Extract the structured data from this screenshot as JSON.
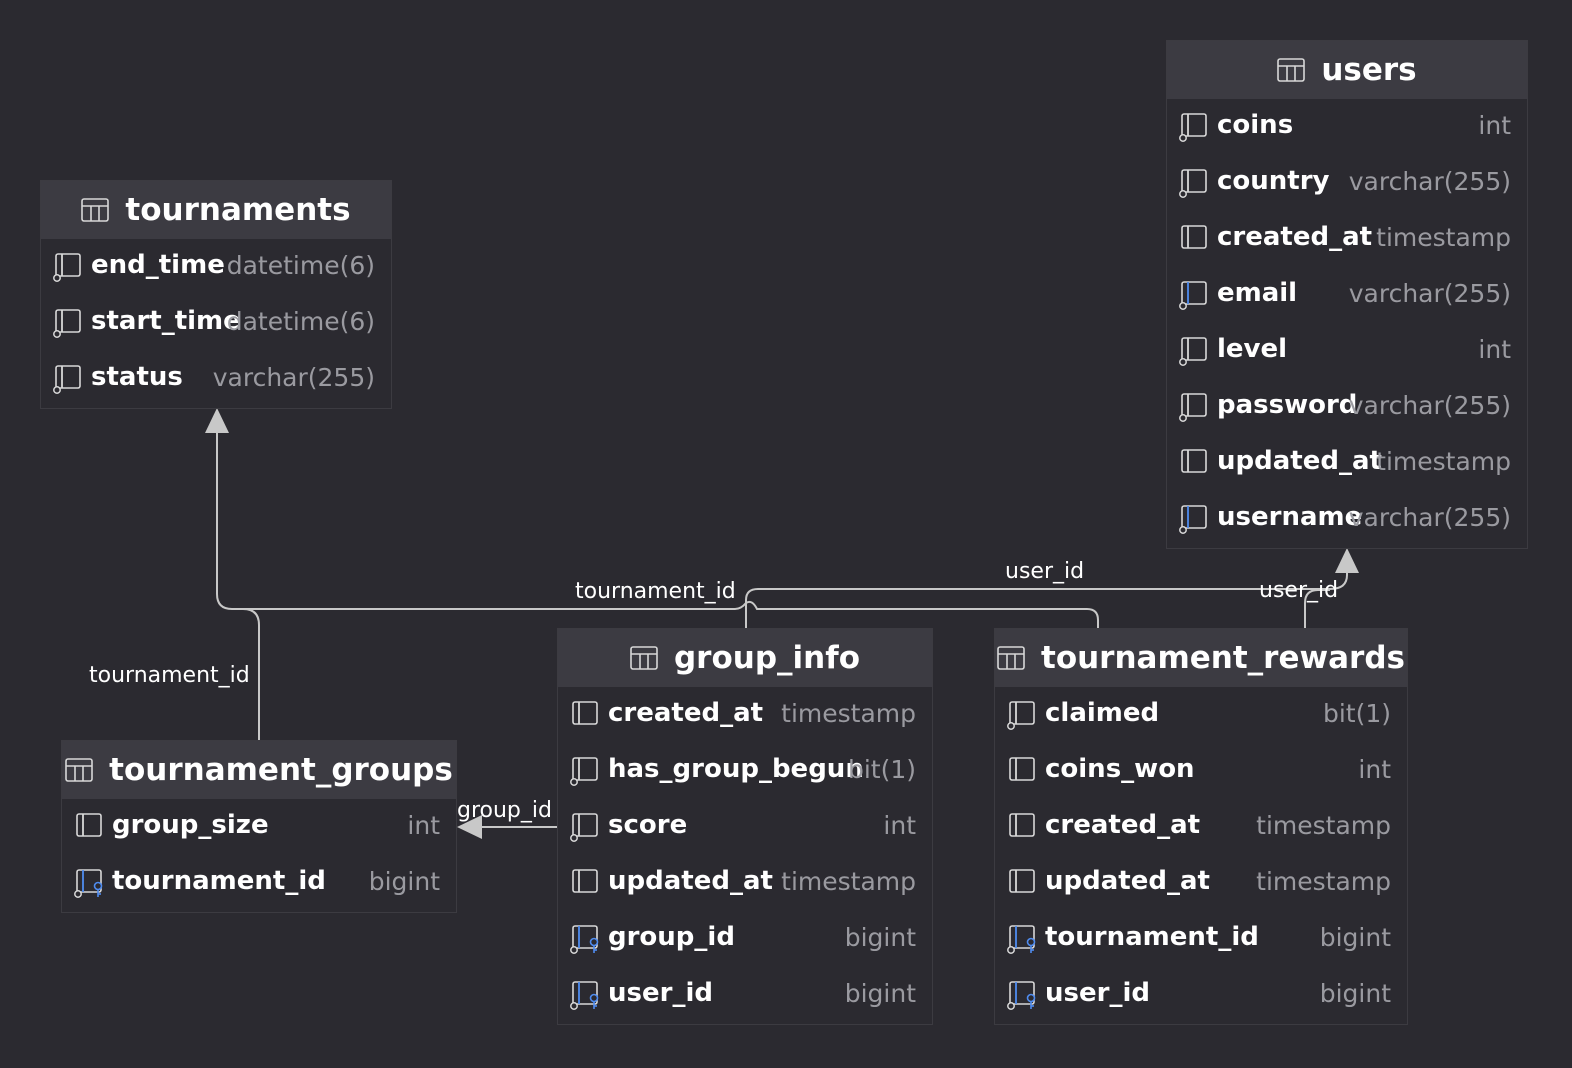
{
  "colors": {
    "background": "#2b2a30",
    "header": "#3c3b42",
    "border": "#3c3b41",
    "text": "#ffffff",
    "type_text": "#9a9aa0",
    "edge": "#c8c8c8",
    "key_icon": "#4f8cf0"
  },
  "tables": {
    "users": {
      "name": "users",
      "columns": [
        {
          "name": "coins",
          "type": "int",
          "icon": "column-nullable-icon"
        },
        {
          "name": "country",
          "type": "varchar(255)",
          "icon": "column-nullable-icon"
        },
        {
          "name": "created_at",
          "type": "timestamp",
          "icon": "column-icon"
        },
        {
          "name": "email",
          "type": "varchar(255)",
          "icon": "column-unique-icon"
        },
        {
          "name": "level",
          "type": "int",
          "icon": "column-nullable-icon"
        },
        {
          "name": "password",
          "type": "varchar(255)",
          "icon": "column-nullable-icon"
        },
        {
          "name": "updated_at",
          "type": "timestamp",
          "icon": "column-icon"
        },
        {
          "name": "username",
          "type": "varchar(255)",
          "icon": "column-unique-icon"
        }
      ]
    },
    "tournaments": {
      "name": "tournaments",
      "columns": [
        {
          "name": "end_time",
          "type": "datetime(6)",
          "icon": "column-nullable-icon"
        },
        {
          "name": "start_time",
          "type": "datetime(6)",
          "icon": "column-nullable-icon"
        },
        {
          "name": "status",
          "type": "varchar(255)",
          "icon": "column-nullable-icon"
        }
      ]
    },
    "group_info": {
      "name": "group_info",
      "columns": [
        {
          "name": "created_at",
          "type": "timestamp",
          "icon": "column-icon"
        },
        {
          "name": "has_group_begun",
          "type": "bit(1)",
          "icon": "column-nullable-icon"
        },
        {
          "name": "score",
          "type": "int",
          "icon": "column-nullable-icon"
        },
        {
          "name": "updated_at",
          "type": "timestamp",
          "icon": "column-icon"
        },
        {
          "name": "group_id",
          "type": "bigint",
          "icon": "foreign-key-icon"
        },
        {
          "name": "user_id",
          "type": "bigint",
          "icon": "foreign-key-icon"
        }
      ]
    },
    "tournament_rewards": {
      "name": "tournament_rewards",
      "columns": [
        {
          "name": "claimed",
          "type": "bit(1)",
          "icon": "column-nullable-icon"
        },
        {
          "name": "coins_won",
          "type": "int",
          "icon": "column-icon"
        },
        {
          "name": "created_at",
          "type": "timestamp",
          "icon": "column-icon"
        },
        {
          "name": "updated_at",
          "type": "timestamp",
          "icon": "column-icon"
        },
        {
          "name": "tournament_id",
          "type": "bigint",
          "icon": "foreign-key-icon"
        },
        {
          "name": "user_id",
          "type": "bigint",
          "icon": "foreign-key-icon"
        }
      ]
    },
    "tournament_groups": {
      "name": "tournament_groups",
      "columns": [
        {
          "name": "group_size",
          "type": "int",
          "icon": "column-icon"
        },
        {
          "name": "tournament_id",
          "type": "bigint",
          "icon": "foreign-key-icon"
        }
      ]
    }
  },
  "relations": [
    {
      "from": "tournament_groups",
      "to": "tournaments",
      "label": "tournament_id"
    },
    {
      "from": "tournament_rewards",
      "to": "tournaments",
      "label": "tournament_id"
    },
    {
      "from": "group_info",
      "to": "users",
      "label": "user_id"
    },
    {
      "from": "tournament_rewards",
      "to": "users",
      "label": "user_id"
    },
    {
      "from": "group_info",
      "to": "tournament_groups",
      "label": "group_id"
    }
  ]
}
